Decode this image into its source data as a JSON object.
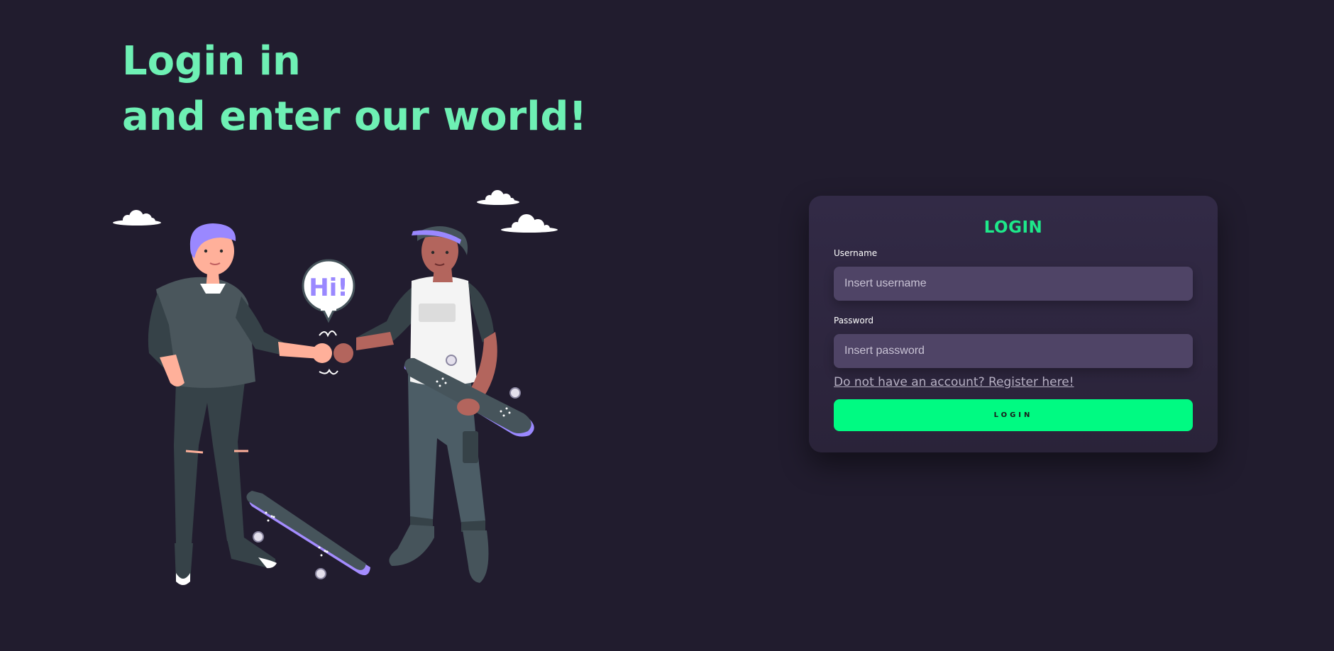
{
  "hero": {
    "line1": "Login in",
    "line2": "and enter our world!"
  },
  "illustration": {
    "speech_bubble": "Hi!"
  },
  "login": {
    "title": "LOGIN",
    "username_label": "Username",
    "username_placeholder": "Insert username",
    "password_label": "Password",
    "password_placeholder": "Insert password",
    "register_link": "Do not have an account? Register here!",
    "button_label": "LOGIN"
  },
  "colors": {
    "background": "#211c2e",
    "accent_green": "#00fa82",
    "hero_text": "#6ef0b4",
    "card_bg": "#2f2842",
    "input_bg": "#4f4466"
  }
}
